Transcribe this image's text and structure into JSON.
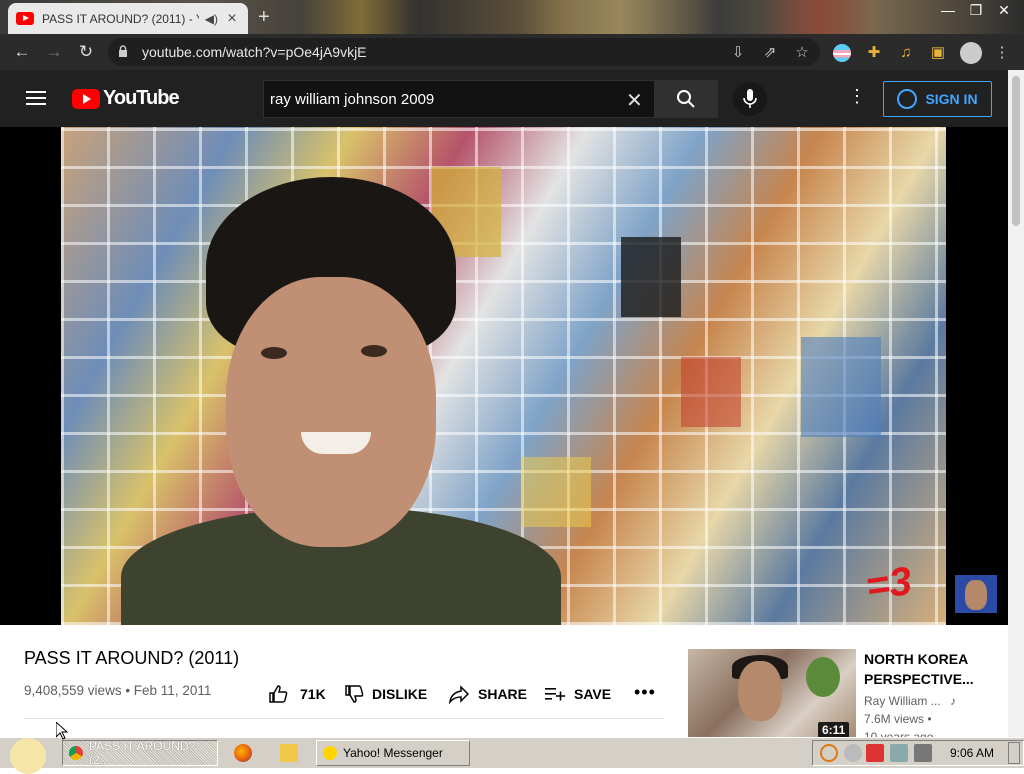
{
  "browser": {
    "tab_title": "PASS IT AROUND? (2011) - Y",
    "url": "youtube.com/watch?v=pOe4jA9vkjE",
    "new_tab": "+",
    "win_min": "—",
    "win_max": "❐",
    "win_close": "✕"
  },
  "youtube": {
    "logo_text": "YouTube",
    "search_value": "ray william johnson 2009",
    "sign_in": "SIGN IN"
  },
  "video": {
    "title": "PASS IT AROUND? (2011)",
    "meta": "9,408,559 views • Feb 11, 2011",
    "watermark": "=3",
    "likes": "71K",
    "dislike": "DISLIKE",
    "share": "SHARE",
    "save": "SAVE",
    "more": "•••"
  },
  "recommended": {
    "title": "NORTH KOREA PERSPECTIVE...",
    "channel": "Ray William ...",
    "views": "7.6M views •",
    "age": "10 years ago",
    "duration": "6:11"
  },
  "taskbar": {
    "tasks": [
      {
        "label": "PASS IT AROUND? (2..."
      },
      {
        "label": "Yahoo! Messenger"
      }
    ],
    "clock": "9:06 AM"
  }
}
